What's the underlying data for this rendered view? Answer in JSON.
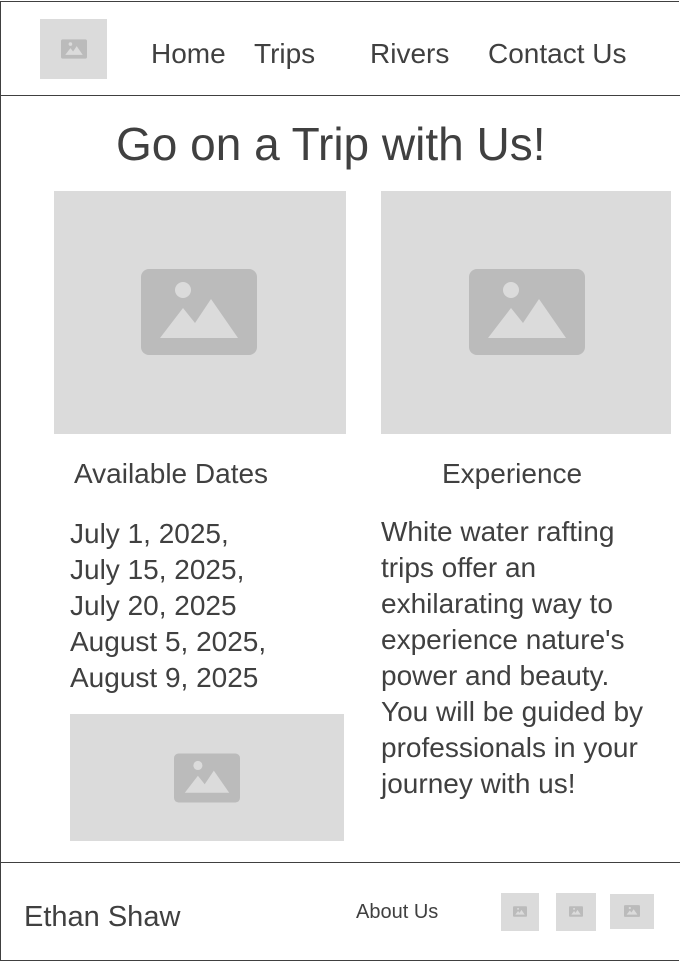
{
  "header": {
    "nav": [
      {
        "label": "Home"
      },
      {
        "label": "Trips"
      },
      {
        "label": "Rivers"
      },
      {
        "label": "Contact Us"
      }
    ]
  },
  "main": {
    "title": "Go on a Trip with Us!",
    "dates": {
      "heading": "Available Dates",
      "items": [
        "July 1, 2025,",
        "July 15, 2025,",
        "July 20, 2025",
        "August 5, 2025,",
        "August 9, 2025"
      ]
    },
    "experience": {
      "heading": "Experience",
      "lines": [
        "White water rafting",
        "trips offer an",
        "exhilarating way to",
        "experience nature's",
        "power and beauty.",
        "You will be guided by",
        "professionals in your",
        "journey with us!"
      ]
    }
  },
  "footer": {
    "name": "Ethan Shaw",
    "about": "About Us"
  },
  "colors": {
    "text": "#404040",
    "placeholder_bg": "#dbdbdb",
    "placeholder_icon": "#bbbbbb"
  }
}
